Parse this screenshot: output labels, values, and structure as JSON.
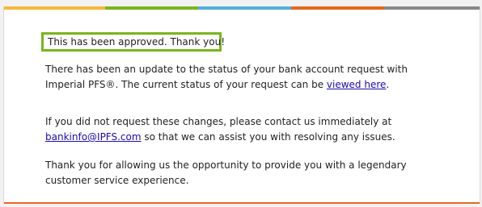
{
  "email": {
    "approval_message": "This has been approved. Thank you!",
    "paragraph1": {
      "before_link": "There has been an update to the status of your bank account request with Imperial PFS®. The current status of your request can be ",
      "link_text": "viewed here",
      "after_link": "."
    },
    "paragraph2": {
      "before_link": "If you did not request these changes, please contact us immediately at ",
      "link_text": "bankinfo@IPFS.com",
      "after_link": " so that we can assist you with resolving any issues."
    },
    "paragraph3": "Thank you for allowing us the opportunity to provide you with a legendary customer service experience."
  },
  "colors": {
    "band": [
      "#f6b83a",
      "#79b51c",
      "#4fb1de",
      "#e8661b",
      "#888888"
    ],
    "highlight_border": "#79b51c",
    "bottom_rule": "#e8661b",
    "link": "#1a0dab"
  }
}
